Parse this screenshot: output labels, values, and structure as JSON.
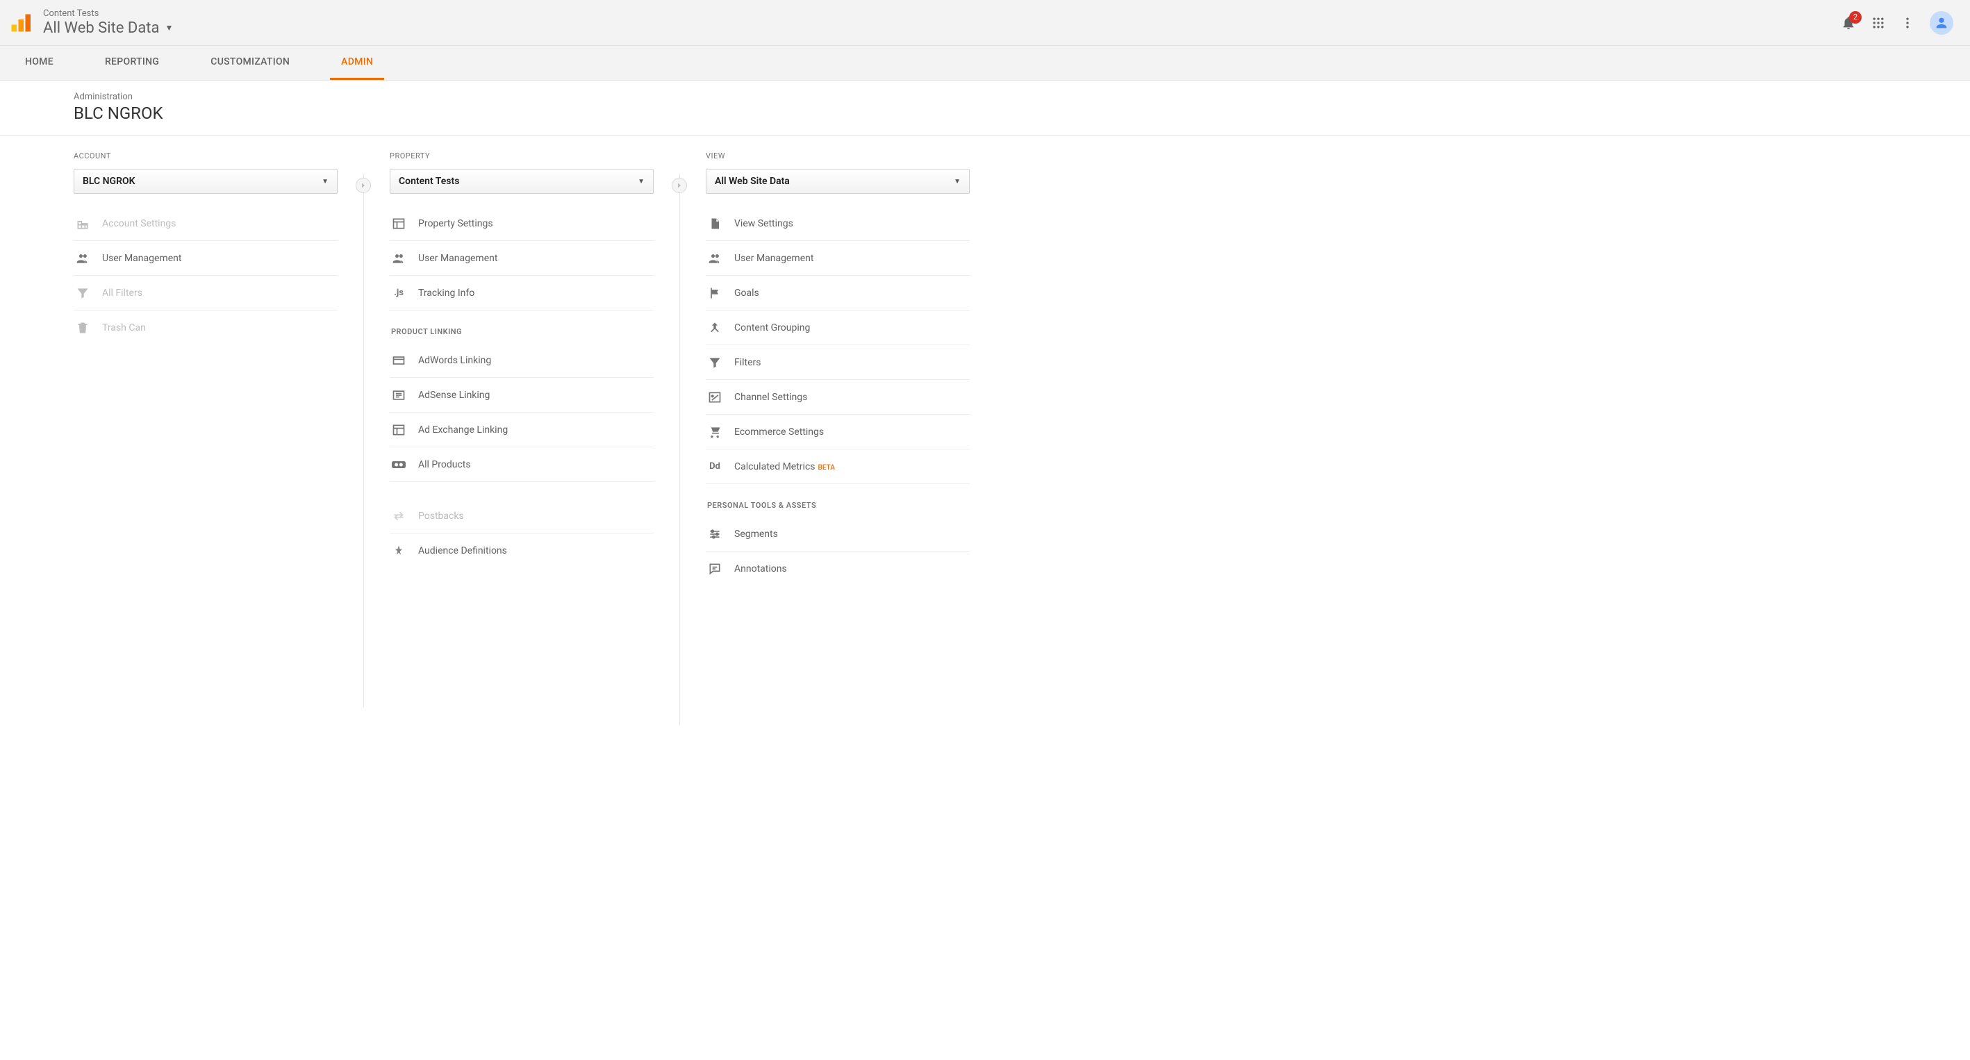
{
  "header": {
    "subtitle": "Content Tests",
    "title": "All Web Site Data",
    "notification_count": "2"
  },
  "tabs": {
    "home": "HOME",
    "reporting": "REPORTING",
    "customization": "CUSTOMIZATION",
    "admin": "ADMIN"
  },
  "page": {
    "crumb": "Administration",
    "account": "BLC NGROK"
  },
  "columns": {
    "account": {
      "label": "ACCOUNT",
      "selected": "BLC NGROK",
      "items": {
        "account_settings": "Account Settings",
        "user_management": "User Management",
        "all_filters": "All Filters",
        "trash_can": "Trash Can"
      }
    },
    "property": {
      "label": "PROPERTY",
      "selected": "Content Tests",
      "items": {
        "property_settings": "Property Settings",
        "user_management": "User Management",
        "tracking_info": "Tracking Info"
      },
      "section_product_linking": "PRODUCT LINKING",
      "product_linking": {
        "adwords": "AdWords Linking",
        "adsense": "AdSense Linking",
        "ad_exchange": "Ad Exchange Linking",
        "all_products": "All Products"
      },
      "items2": {
        "postbacks": "Postbacks",
        "audience_definitions": "Audience Definitions"
      }
    },
    "view": {
      "label": "VIEW",
      "selected": "All Web Site Data",
      "items": {
        "view_settings": "View Settings",
        "user_management": "User Management",
        "goals": "Goals",
        "content_grouping": "Content Grouping",
        "filters": "Filters",
        "channel_settings": "Channel Settings",
        "ecommerce_settings": "Ecommerce Settings",
        "calculated_metrics": "Calculated Metrics",
        "beta": "BETA"
      },
      "section_personal": "PERSONAL TOOLS & ASSETS",
      "personal": {
        "segments": "Segments",
        "annotations": "Annotations"
      }
    }
  }
}
